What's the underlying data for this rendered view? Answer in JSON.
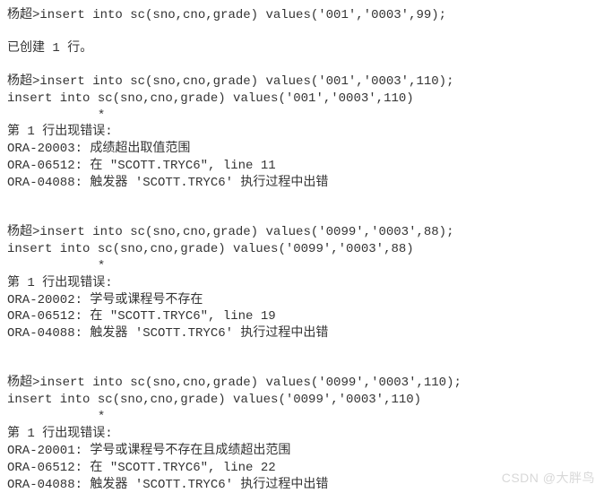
{
  "prompt": "杨超>",
  "blocks": {
    "b1": {
      "cmd": "insert into sc(sno,cno,grade) values('001','0003',99);",
      "result": "已创建 1 行。"
    },
    "b2": {
      "cmd": "insert into sc(sno,cno,grade) values('001','0003',110);",
      "echo": "insert into sc(sno,cno,grade) values('001','0003',110)",
      "marker": "            *",
      "err_header": "第 1 行出现错误:",
      "ora1": "ORA-20003: 成绩超出取值范围",
      "ora2": "ORA-06512: 在 \"SCOTT.TRYC6\", line 11",
      "ora3": "ORA-04088: 触发器 'SCOTT.TRYC6' 执行过程中出错"
    },
    "b3": {
      "cmd": "insert into sc(sno,cno,grade) values('0099','0003',88);",
      "echo": "insert into sc(sno,cno,grade) values('0099','0003',88)",
      "marker": "            *",
      "err_header": "第 1 行出现错误:",
      "ora1": "ORA-20002: 学号或课程号不存在",
      "ora2": "ORA-06512: 在 \"SCOTT.TRYC6\", line 19",
      "ora3": "ORA-04088: 触发器 'SCOTT.TRYC6' 执行过程中出错"
    },
    "b4": {
      "cmd": "insert into sc(sno,cno,grade) values('0099','0003',110);",
      "echo": "insert into sc(sno,cno,grade) values('0099','0003',110)",
      "marker": "            *",
      "err_header": "第 1 行出现错误:",
      "ora1": "ORA-20001: 学号或课程号不存在且成绩超出范围",
      "ora2": "ORA-06512: 在 \"SCOTT.TRYC6\", line 22",
      "ora3": "ORA-04088: 触发器 'SCOTT.TRYC6' 执行过程中出错"
    }
  },
  "watermark": "CSDN @大胖鸟"
}
